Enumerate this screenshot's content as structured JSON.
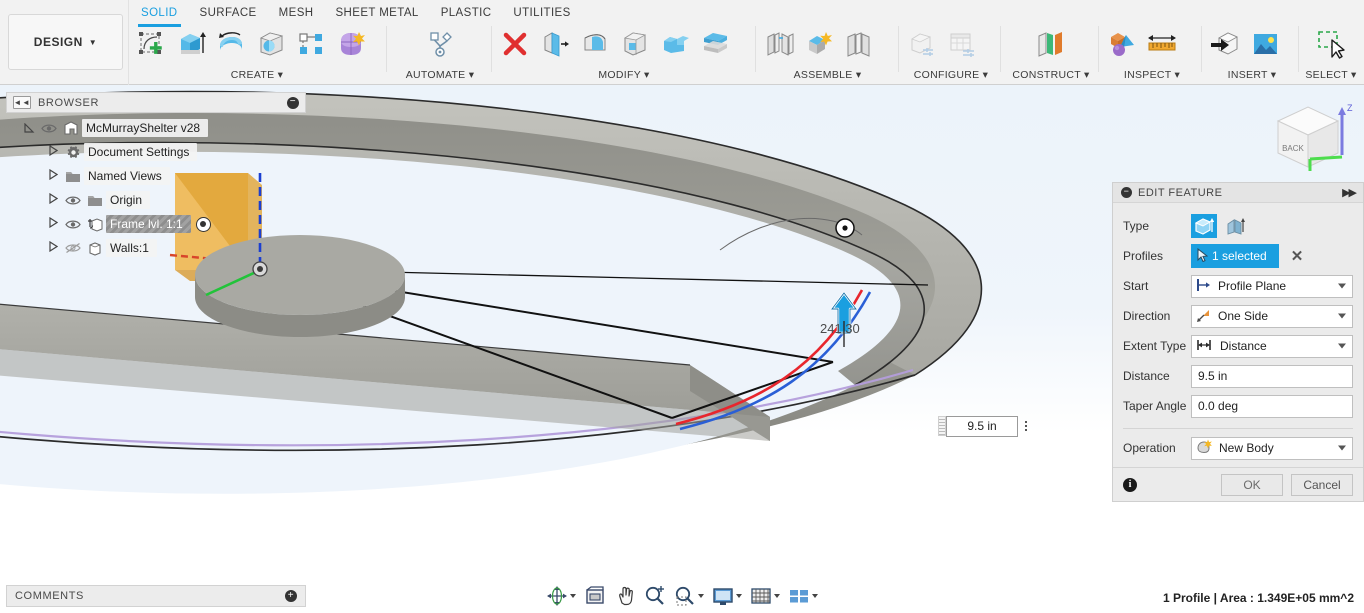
{
  "app": {
    "workspace_label": "DESIGN",
    "workspace_caret": "▼"
  },
  "ribbon": {
    "tabs": [
      {
        "label": "SOLID",
        "active": true
      },
      {
        "label": "SURFACE",
        "active": false
      },
      {
        "label": "MESH",
        "active": false
      },
      {
        "label": "SHEET METAL",
        "active": false
      },
      {
        "label": "PLASTIC",
        "active": false
      },
      {
        "label": "UTILITIES",
        "active": false
      }
    ],
    "groups": [
      {
        "label": "CREATE ▾",
        "icons": [
          "new-sketch-icon",
          "extrude-icon",
          "revolve-icon",
          "sweep-icon",
          "pattern-icon",
          "form-icon"
        ]
      },
      {
        "label": "AUTOMATE ▾",
        "icons": [
          "automate-icon"
        ]
      },
      {
        "label": "MODIFY ▾",
        "icons": [
          "delete-icon",
          "press-pull-icon",
          "fillet-icon",
          "shell-icon",
          "combine-icon",
          "offset-face-icon"
        ]
      },
      {
        "label": "ASSEMBLE ▾",
        "icons": [
          "joint-icon",
          "new-component-icon",
          "as-built-joint-icon"
        ]
      },
      {
        "label": "CONFIGURE ▾",
        "icons": [
          "configure-icon",
          "configure-table-icon"
        ]
      },
      {
        "label": "CONSTRUCT ▾",
        "icons": [
          "construct-plane-icon"
        ]
      },
      {
        "label": "INSPECT ▾",
        "icons": [
          "inspect-interference-icon",
          "measure-icon"
        ]
      },
      {
        "label": "INSERT ▾",
        "icons": [
          "insert-derive-icon",
          "insert-image-icon"
        ]
      },
      {
        "label": "SELECT ▾",
        "icons": [
          "select-window-icon"
        ]
      }
    ]
  },
  "browser": {
    "title": "BROWSER",
    "collapse_icon": "collapse-left-icon",
    "minimize_icon": "minus-icon",
    "items": [
      {
        "label": "McMurrayShelter v28",
        "icon": "component-icon",
        "caret": "expanded",
        "eye": "visible",
        "indent": 0,
        "selected": false
      },
      {
        "label": "Document Settings",
        "icon": "gear-icon",
        "caret": "collapsed",
        "eye": "none",
        "indent": 1,
        "selected": false
      },
      {
        "label": "Named Views",
        "icon": "folder-icon",
        "caret": "collapsed",
        "eye": "none",
        "indent": 1,
        "selected": false
      },
      {
        "label": "Origin",
        "icon": "folder-icon",
        "caret": "collapsed",
        "eye": "visible",
        "indent": 1,
        "selected": false
      },
      {
        "label": "Frame lvl. 1:1",
        "icon": "grounded-component-icon",
        "caret": "collapsed",
        "eye": "visible",
        "indent": 1,
        "selected": true,
        "activated": true
      },
      {
        "label": "Walls:1",
        "icon": "body-icon",
        "caret": "collapsed",
        "eye": "hidden",
        "indent": 1,
        "selected": false
      }
    ]
  },
  "edit_panel": {
    "title": "EDIT FEATURE",
    "collapse_icon": "minus-circle-icon",
    "expand_icon": "expand-right-icon",
    "rows": {
      "type_label": "Type",
      "type_options": [
        "extrude-solid-icon",
        "extrude-thin-icon"
      ],
      "type_selected_index": 0,
      "profiles_label": "Profiles",
      "profiles_value": "1 selected",
      "profiles_clear_icon": "x-icon",
      "start_label": "Start",
      "start_value": "Profile Plane",
      "start_icon": "profile-plane-icon",
      "direction_label": "Direction",
      "direction_value": "One Side",
      "direction_icon": "one-side-icon",
      "extent_label": "Extent Type",
      "extent_value": "Distance",
      "extent_icon": "distance-icon",
      "distance_label": "Distance",
      "distance_value": "9.5 in",
      "taper_label": "Taper Angle",
      "taper_value": "0.0 deg",
      "operation_label": "Operation",
      "operation_value": "New Body",
      "operation_icon": "new-body-icon"
    },
    "footer": {
      "info_icon": "info-icon",
      "ok_label": "OK",
      "cancel_label": "Cancel"
    }
  },
  "canvas": {
    "dimension_label": "241.30",
    "distance_field_value": "9.5 in",
    "manipulator_icon": "extrude-arrow-up-icon",
    "viewcube_face": "BACK",
    "viewcube_axis": "Z",
    "colors": {
      "accent": "#1a9fe0",
      "background_top": "#ecf3fa",
      "background_bottom": "#ffffff",
      "profile_red": "#e8262d",
      "profile_blue": "#2a5fd6",
      "body_gray": "#9a9a95",
      "sketch_orange": "#f0a830"
    }
  },
  "comments": {
    "title": "COMMENTS",
    "add_icon": "plus-icon"
  },
  "navbar": {
    "buttons": [
      {
        "name": "orbit-icon",
        "caret": true
      },
      {
        "name": "look-at-icon",
        "caret": false
      },
      {
        "name": "pan-icon",
        "caret": false
      },
      {
        "name": "zoom-icon",
        "caret": false
      },
      {
        "name": "zoom-window-icon",
        "caret": true
      },
      {
        "name": "display-settings-icon",
        "caret": true
      },
      {
        "name": "grid-snap-icon",
        "caret": true
      },
      {
        "name": "viewports-icon",
        "caret": true
      }
    ]
  },
  "status": {
    "text": "1 Profile | Area : 1.349E+05 mm^2"
  }
}
